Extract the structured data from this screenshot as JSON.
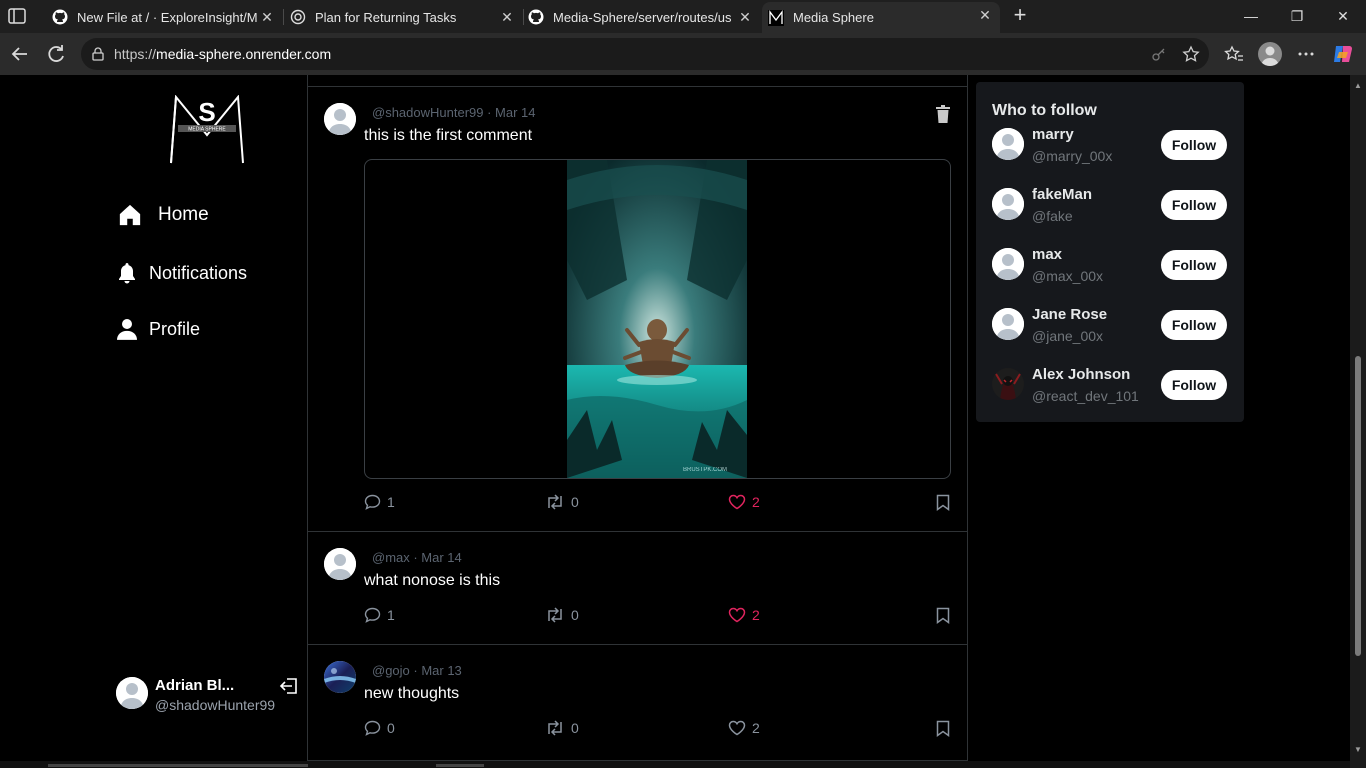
{
  "browser": {
    "tabs": [
      {
        "title": "New File at / · ExploreInsight/Media-Sphere",
        "icon": "github-icon"
      },
      {
        "title": "Plan for Returning Tasks",
        "icon": "openai-icon"
      },
      {
        "title": "Media-Sphere/server/routes/user.route.js",
        "icon": "github-icon"
      },
      {
        "title": "Media Sphere",
        "icon": "media-sphere-favicon"
      }
    ],
    "close_glyph": "✕",
    "newtab_glyph": "+",
    "window_controls": {
      "minimize": "—",
      "maximize": "❐",
      "close": "✕"
    },
    "url_host": "https://media-sphere.onrender.com",
    "url_prefix": "https://",
    "url_domain": "media-sphere.onrender.com"
  },
  "sidebar": {
    "logo_text": "MEDIA SPHERE",
    "logo_letters": "S",
    "nav": [
      {
        "label": "Home",
        "icon": "home-icon"
      },
      {
        "label": "Notifications",
        "icon": "bell-icon"
      },
      {
        "label": "Profile",
        "icon": "user-icon"
      }
    ],
    "user": {
      "name": "Adrian Bl...",
      "handle": "@shadowHunter99"
    }
  },
  "feed": {
    "posts": [
      {
        "handle": "@shadowHunter99",
        "date": "Mar 14",
        "meta": "@shadowHunter99 · Mar 14",
        "text": "this is the first comment",
        "has_image": true,
        "image_caption": "BRUSTPK.COM",
        "comments": "1",
        "reposts": "0",
        "likes": "2",
        "liked": true,
        "deletable": true
      },
      {
        "handle": "@max",
        "date": "Mar 14",
        "meta": "@max · Mar 14",
        "text": "what nonose is this",
        "comments": "1",
        "reposts": "0",
        "likes": "2",
        "liked": true
      },
      {
        "handle": "@gojo",
        "date": "Mar 13",
        "meta": "@gojo · Mar 13",
        "text": "new thoughts",
        "comments": "0",
        "reposts": "0",
        "likes": "2",
        "liked": false
      }
    ]
  },
  "who_to_follow": {
    "title": "Who to follow",
    "button_label": "Follow",
    "users": [
      {
        "name": "marry",
        "handle": "@marry_00x"
      },
      {
        "name": "fakeMan",
        "handle": "@fake"
      },
      {
        "name": "max",
        "handle": "@max_00x"
      },
      {
        "name": "Jane Rose",
        "handle": "@jane_00x"
      },
      {
        "name": "Alex Johnson",
        "handle": "@react_dev_101"
      }
    ]
  },
  "colors": {
    "like_active": "#e0245e",
    "panel_bg": "#16181c",
    "border": "#2f3336",
    "muted_text": "#71767b"
  }
}
